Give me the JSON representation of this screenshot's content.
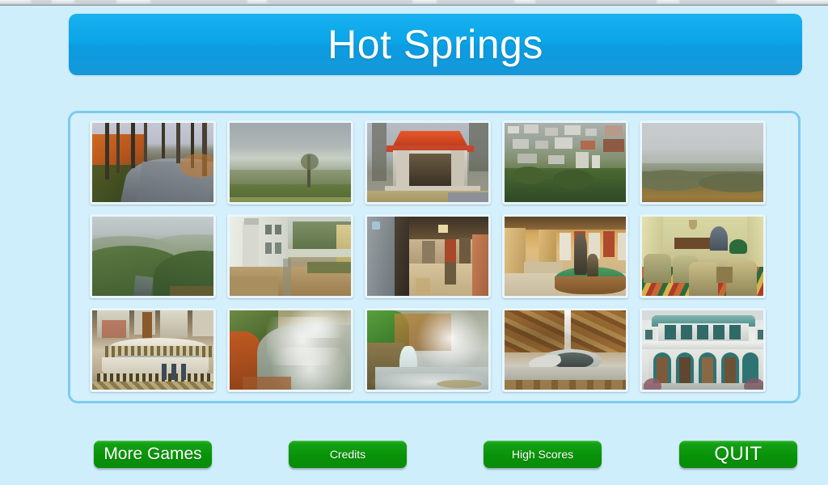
{
  "window": {
    "chrome_strip_visible": true
  },
  "header": {
    "title": "Hot Springs",
    "banner_color": "#0aa4e8",
    "title_color": "#ffffff"
  },
  "theme": {
    "background": "#cfeefc",
    "panel_fill": "#d4f0fd",
    "panel_border": "#7ccbef",
    "thumb_border": "#e8f6fd",
    "button_green": "#089308"
  },
  "gallery": {
    "columns": 5,
    "rows": 3,
    "count": 15,
    "tiles": [
      {
        "index": 1,
        "name": "forest-road",
        "caption": "Paved road through bare winter forest with orange leaf banks"
      },
      {
        "index": 2,
        "name": "mountain-overlook",
        "caption": "Hazy valley overlook with grassy foreground"
      },
      {
        "index": 3,
        "name": "red-roof-pavilion",
        "caption": "Stone pavilion with red tile roof on mountain drive"
      },
      {
        "index": 4,
        "name": "town-aerial-view",
        "caption": "Aerial view of downtown buildings among wooded hills"
      },
      {
        "index": 5,
        "name": "misty-mountain-vista",
        "caption": "Overcast sky above rolling rust colored forest ridges"
      },
      {
        "index": 6,
        "name": "wooded-hillside",
        "caption": "Green wooded hillside with misty ridges beyond"
      },
      {
        "index": 7,
        "name": "bathhouse-row-promenade",
        "caption": "White bathhouse building beside brick garden promenade"
      },
      {
        "index": 8,
        "name": "bathhouse-corridor",
        "caption": "Marble bathhouse corridor with wooden dressing stalls"
      },
      {
        "index": 9,
        "name": "statue-fountain-hall",
        "caption": "Bathhouse hall with bronze statue fountain on green basin"
      },
      {
        "index": 10,
        "name": "hotel-lounge",
        "caption": "Historic lounge with floral carpet and upholstered armchairs"
      },
      {
        "index": 11,
        "name": "thermal-tub-room",
        "caption": "Tiled thermal soaking pool with mosaic surround"
      },
      {
        "index": 12,
        "name": "steaming-spring",
        "caption": "Steam rising from rocky hot spring runoff"
      },
      {
        "index": 13,
        "name": "steaming-cascade",
        "caption": "Thermal water cascading over mossy rocks in steam"
      },
      {
        "index": 14,
        "name": "rock-wall-fountain",
        "caption": "Jet fountain in stone basin against tufa rock wall"
      },
      {
        "index": 15,
        "name": "fordyce-bathhouse-facade",
        "caption": "White bathhouse facade with teal arched entryways"
      }
    ]
  },
  "buttons": {
    "more_games": "More Games",
    "credits": "Credits",
    "high_scores": "High Scores",
    "quit": "QUIT"
  }
}
